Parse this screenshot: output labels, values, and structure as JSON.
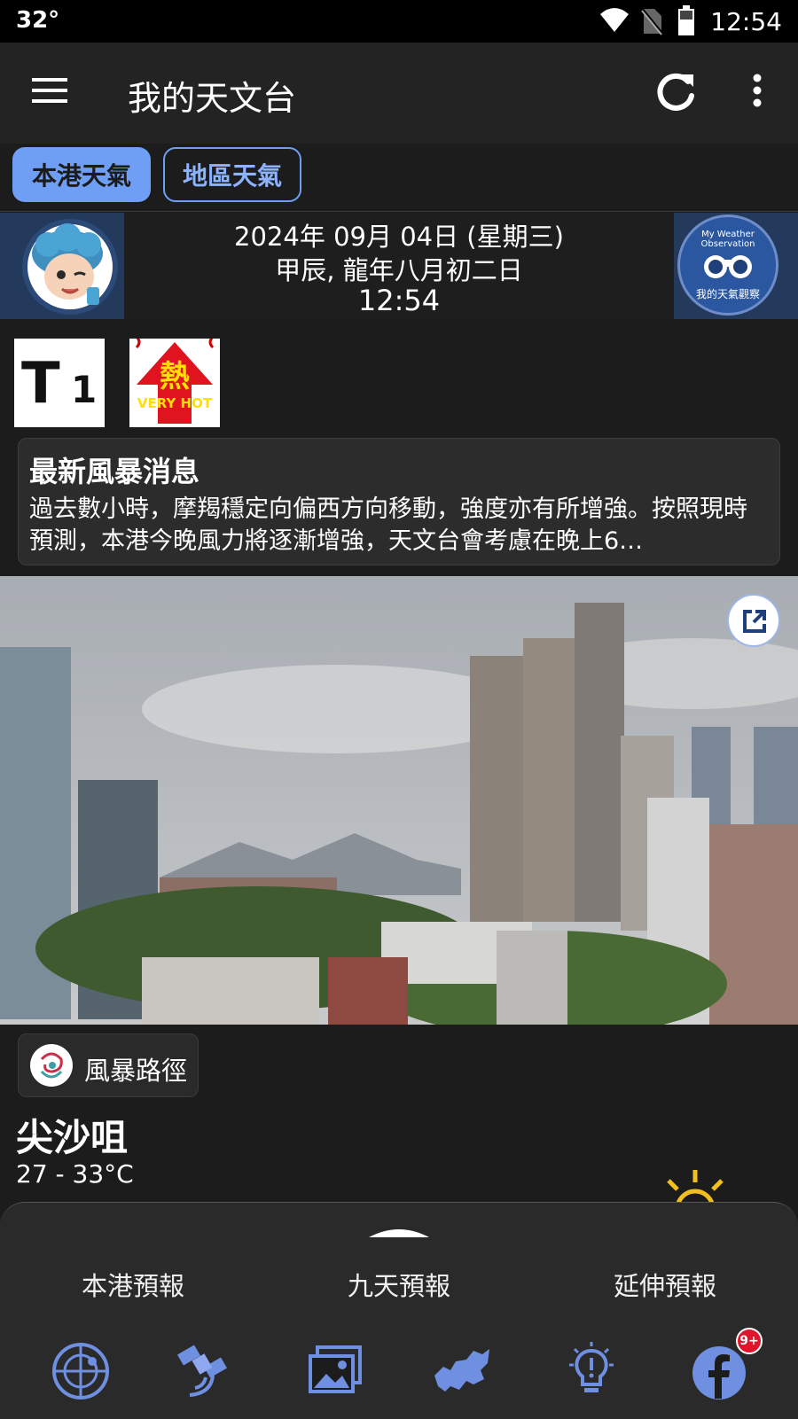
{
  "status_bar": {
    "temperature": "32°",
    "time": "12:54"
  },
  "app_bar": {
    "title": "我的天文台"
  },
  "tabs": [
    {
      "label": "本港天氣",
      "selected": true
    },
    {
      "label": "地區天氣",
      "selected": false
    }
  ],
  "date_banner": {
    "gregorian": "2024年 09月 04日 (星期三)",
    "lunar": "甲辰, 龍年八月初二日",
    "time": "12:54",
    "observation_badge_top": "My Weather Observation",
    "observation_badge_bottom": "我的天氣觀察"
  },
  "warnings": [
    {
      "icon": "typhoon-signal-1-icon",
      "text": "T1"
    },
    {
      "icon": "very-hot-warning-icon",
      "text_cn": "熱",
      "text_en": "VERY HOT"
    }
  ],
  "storm_message": {
    "heading": "最新風暴消息",
    "body": "過去數小時，摩羯穩定向偏西方向移動，強度亦有所增強。按照現時預測，本港今晚風力將逐漸增強，天文台會考慮在晚上6…"
  },
  "storm_track": {
    "label": "風暴路徑",
    "icon": "typhoon-icon"
  },
  "location": {
    "name": "尖沙咀",
    "temp_range": "27 - 33°C",
    "weather_icon": "sunny-icon"
  },
  "forecast_tabs": [
    "本港預報",
    "九天預報",
    "延伸預報"
  ],
  "bottom_nav": [
    {
      "icon": "radar-icon"
    },
    {
      "icon": "satellite-icon"
    },
    {
      "icon": "image-gallery-icon"
    },
    {
      "icon": "hong-kong-map-icon"
    },
    {
      "icon": "weather-tips-icon"
    },
    {
      "icon": "facebook-icon",
      "badge": "9+"
    }
  ],
  "colors": {
    "accent": "#6f9ff5",
    "badge": "#e0142a",
    "background": "#1c1c1c"
  }
}
